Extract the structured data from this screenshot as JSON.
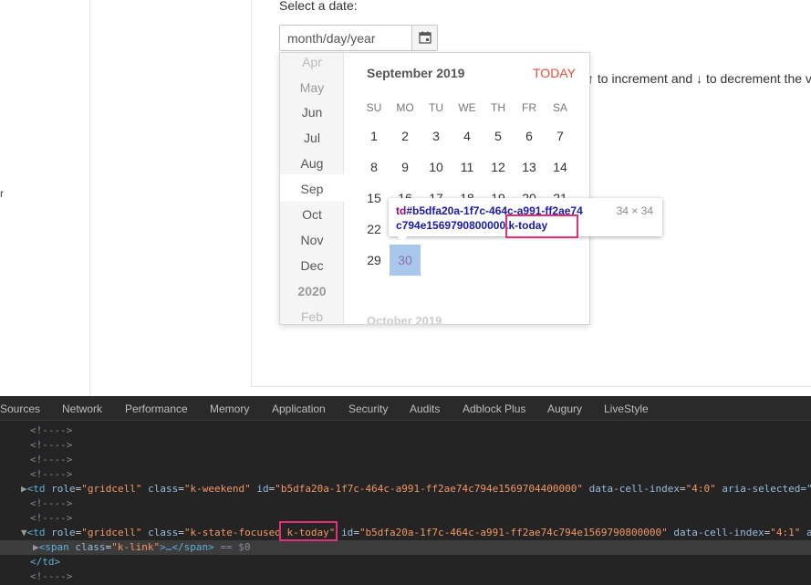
{
  "page": {
    "stray_char": "r",
    "select_label": "Select a date:",
    "date_placeholder": "month/day/year",
    "hint_text": "↑ to increment and ↓ to decrement the v"
  },
  "calendar": {
    "months": [
      "Apr",
      "May",
      "Jun",
      "Jul",
      "Aug",
      "Sep",
      "Oct",
      "Nov",
      "Dec",
      "2020",
      "Feb"
    ],
    "selected_month": "Sep",
    "title": "September 2019",
    "today_label": "TODAY",
    "weekdays": [
      "SU",
      "MO",
      "TU",
      "WE",
      "TH",
      "FR",
      "SA"
    ],
    "weeks": [
      [
        "1",
        "2",
        "3",
        "4",
        "5",
        "6",
        "7"
      ],
      [
        "8",
        "9",
        "10",
        "11",
        "12",
        "13",
        "14"
      ],
      [
        "15",
        "16",
        "17",
        "18",
        "19",
        "20",
        "21"
      ],
      [
        "22",
        "23",
        "24",
        "25",
        "26",
        "27",
        "28"
      ],
      [
        "29",
        "30",
        "",
        "",
        "",
        "",
        ""
      ]
    ],
    "today_day": "30",
    "next_month_label": "October 2019"
  },
  "tooltip": {
    "tag": "td",
    "line1_rest": "#b5dfa20a-1f7c-464c-a991-ff2ae74",
    "line2": "c794e1569790800000.k-today",
    "dims": "34 × 34"
  },
  "devtools": {
    "tabs": [
      "Sources",
      "Network",
      "Performance",
      "Memory",
      "Application",
      "Security",
      "Audits",
      "Adblock Plus",
      "Augury",
      "LiveStyle"
    ],
    "comment": "<!---->",
    "row1": {
      "open": "<td",
      "role_attr": "role",
      "role_val": "\"gridcell\"",
      "class_attr": "class",
      "class_val": "\"k-weekend\"",
      "id_attr": "id",
      "id_val": "\"b5dfa20a-1f7c-464c-a991-ff2ae74c794e1569704400000\"",
      "idx_attr": "data-cell-index",
      "idx_val": "\"4:0\"",
      "aria_attr": "aria-selected=\""
    },
    "row2": {
      "open": "<td",
      "role_attr": "role",
      "role_val": "\"gridcell\"",
      "class_attr": "class",
      "class_val": "\"k-state-focused k-today\"",
      "id_attr": "id",
      "id_val": "\"b5dfa20a-1f7c-464c-a991-ff2ae74c794e1569790800000\"",
      "idx_attr": "data-cell-index",
      "idx_val": "\"4:1\"",
      "tail": "a"
    },
    "span_line": {
      "open": "<span",
      "class_attr": "class",
      "class_val": "\"k-link\"",
      "ellipsis": ">…</span>",
      "eq": "== $0"
    },
    "close_td": "</td>"
  }
}
